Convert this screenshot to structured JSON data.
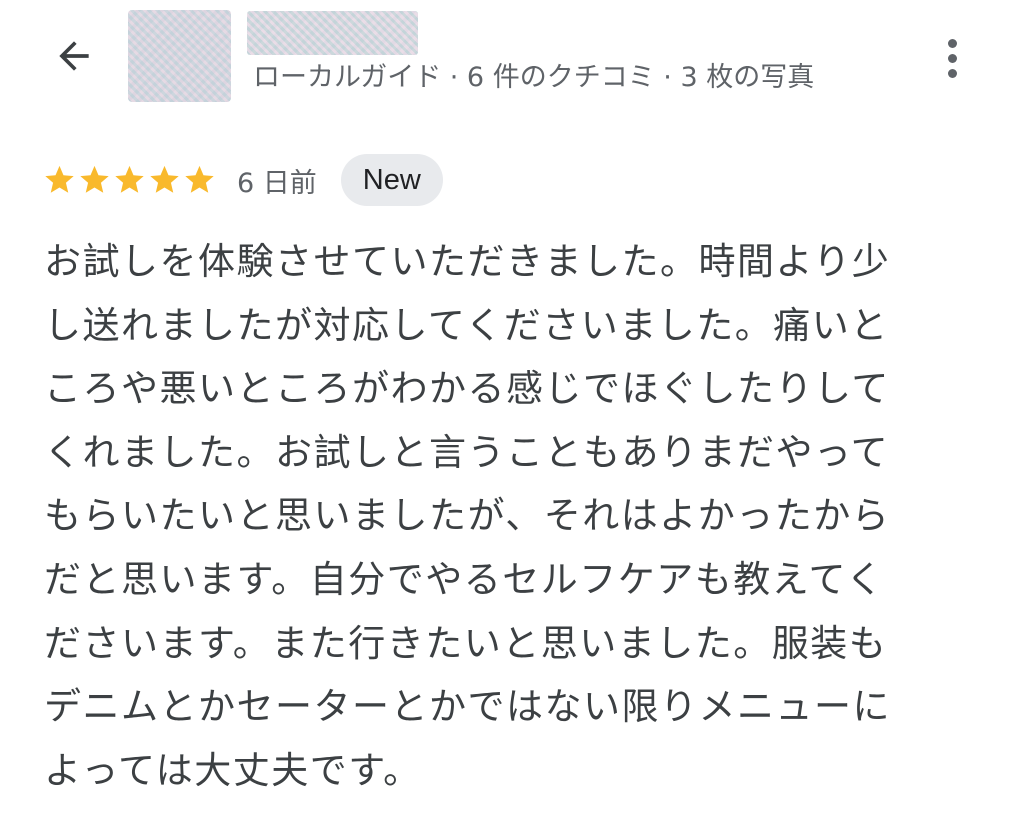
{
  "header": {
    "back_icon": "arrow-left-icon",
    "reviewer_meta": "ローカルガイド · 6 件のクチコミ · 3 枚の写真",
    "more_icon": "more-vert-icon"
  },
  "review": {
    "rating": 5,
    "rating_max": 5,
    "star_color": "#F9B92C",
    "date": "6 日前",
    "badge": "New",
    "lines": [
      "お試しを体験させていただきました。時間より少",
      "し送れましたが対応してくださいました。痛いと",
      "ころや悪いところがわかる感じでほぐしたりして",
      "くれました。お試しと言うこともありまだやって",
      "もらいたいと思いましたが、それはよかったから",
      "だと思います。自分でやるセルフケアも教えてく",
      "ださいます。また行きたいと思いました。服装も",
      "デニムとかセーターとかではない限りメニューに",
      "よっては大丈夫です。"
    ]
  }
}
